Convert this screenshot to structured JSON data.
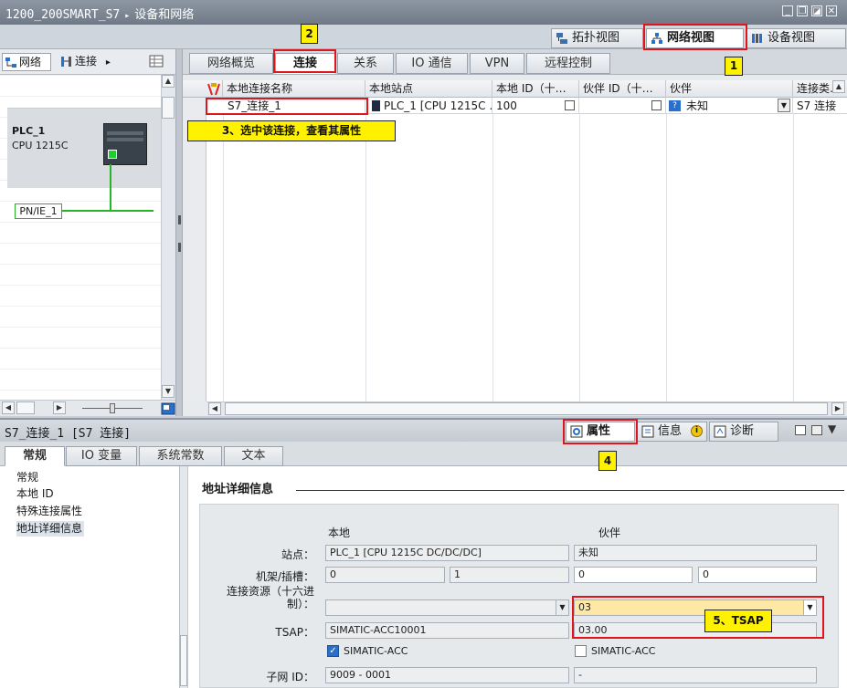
{
  "title_bar": {
    "project": "1200_200SMART_S7",
    "separator": "▸",
    "section": "设备和网络",
    "buttons": [
      "_",
      "❐",
      "◪",
      "✕"
    ]
  },
  "view_tabs": [
    {
      "label": "拓扑视图",
      "icon": "topology-view-icon",
      "active": false
    },
    {
      "label": "网络视图",
      "icon": "network-view-icon",
      "active": true
    },
    {
      "label": "设备视图",
      "icon": "device-view-icon",
      "active": false
    }
  ],
  "left_toolbar": {
    "network_label": "网络",
    "connection_label": "连接",
    "connection_arrow": "▸"
  },
  "device": {
    "name": "PLC_1",
    "cpu": "CPU 1215C",
    "network": "PN/IE_1"
  },
  "editor_tabs": [
    "网络概览",
    "连接",
    "关系",
    "IO 通信",
    "VPN",
    "远程控制"
  ],
  "editor_active_tab": "连接",
  "table": {
    "columns": [
      "本地连接名称",
      "本地站点",
      "本地 ID（十…",
      "伙伴 ID（十…",
      "伙伴",
      "连接类…"
    ],
    "row": {
      "local_name": "S7_连接_1",
      "local_station": "PLC_1 [CPU 1215C …",
      "local_id": "100",
      "partner_id": "",
      "partner": "未知",
      "type": "S7 连接"
    }
  },
  "inspector": {
    "title": "S7_连接_1 [S7 连接]",
    "tabs": [
      {
        "label": "属性",
        "icon": "properties-icon",
        "active": true
      },
      {
        "label": "信息",
        "icon": "info-icon",
        "active": false
      },
      {
        "label": "诊断",
        "icon": "diagnostics-icon",
        "active": false
      }
    ],
    "info_badge": "i",
    "subtabs": [
      "常规",
      "IO 变量",
      "系统常数",
      "文本"
    ],
    "active_subtab": "常规",
    "nav": [
      "常规",
      "本地 ID",
      "特殊连接属性",
      "地址详细信息"
    ],
    "nav_selected": "地址详细信息"
  },
  "address_details": {
    "section_title": "地址详细信息",
    "col_local": "本地",
    "col_partner": "伙伴",
    "rows": {
      "station_label": "站点：",
      "station_local": "PLC_1 [CPU 1215C DC/DC/DC]",
      "station_partner": "未知",
      "rack_label": "机架/插槽：",
      "rack_local": "0",
      "slot_local": "1",
      "rack_partner": "0",
      "slot_partner": "0",
      "resource_label_1": "连接资源（十六进",
      "resource_label_2": "制）：",
      "resource_local": "",
      "resource_partner": "03",
      "tsap_label": "TSAP：",
      "tsap_local": "SIMATIC-ACC10001",
      "tsap_partner": "03.00",
      "simatic_acc_local_label": "SIMATIC-ACC",
      "simatic_acc_local_checked": true,
      "simatic_acc_partner_label": "SIMATIC-ACC",
      "simatic_acc_partner_checked": false,
      "subnet_label": "子网 ID：",
      "subnet_local": "9009 - 0001",
      "subnet_partner": "-"
    }
  },
  "annotations": {
    "step1": "1",
    "step2": "2",
    "step3": "3、选中该连接，查看其属性",
    "step4": "4",
    "step5": "5、TSAP"
  },
  "colors": {
    "highlight_red": "#e0141c",
    "callout_yellow": "#fff200",
    "link_green": "#28b428",
    "partner_resource_bg": "#fde8a6"
  }
}
